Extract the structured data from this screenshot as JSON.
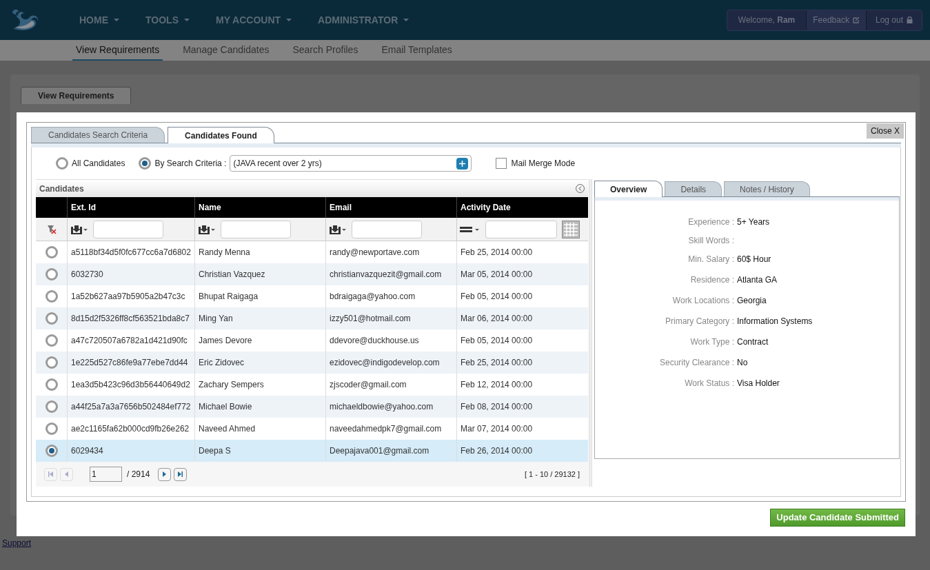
{
  "header": {
    "menu": [
      {
        "label": "HOME"
      },
      {
        "label": "TOOLS"
      },
      {
        "label": "MY ACCOUNT"
      },
      {
        "label": "ADMINISTRATOR"
      }
    ],
    "welcome": "Welcome, **Ram**",
    "feedback": "Feedback",
    "logout": "Log out"
  },
  "subnav": [
    {
      "label": "View Requirements",
      "selected": true
    },
    {
      "label": "Manage Candidates",
      "selected": false
    },
    {
      "label": "Search Profiles",
      "selected": false
    },
    {
      "label": "Email Templates",
      "selected": false
    }
  ],
  "page_tab": "View Requirements",
  "footer_link": "Support",
  "dialog": {
    "close": "Close X",
    "tabs": [
      {
        "label": "Candidates Search Criteria",
        "selected": false
      },
      {
        "label": "Candidates Found",
        "selected": true
      }
    ],
    "scope": [
      {
        "label": "All Candidates",
        "selected": false
      },
      {
        "label": "By Search Criteria :",
        "selected": true
      }
    ],
    "criteria": "(JAVA recent over 2 yrs)",
    "mail_merge": {
      "label": "Mail Merge Mode",
      "checked": false
    },
    "grid": {
      "title": "Candidates",
      "columns": [
        "Ext. Id",
        "Name",
        "Email",
        "Activity Date"
      ],
      "rows": [
        {
          "selected": false,
          "cells": [
            "a5118bf34d5f0fc677cc6a7d6802",
            "Randy Menna",
            "randy@newportave.com",
            "Feb 25, 2014 00:00"
          ]
        },
        {
          "selected": false,
          "cells": [
            "6032730",
            "Christian Vazquez",
            "christianvazquezit@gmail.com",
            "Mar 05, 2014 00:00"
          ]
        },
        {
          "selected": false,
          "cells": [
            "1a52b627aa97b5905a2b47c3c",
            "Bhupat Raigaga",
            "bdraigaga@yahoo.com",
            "Feb 05, 2014 00:00"
          ]
        },
        {
          "selected": false,
          "cells": [
            "8d15d2f5326ff8cf563521bda8c7",
            "Ming Yan",
            "izzy501@hotmail.com",
            "Mar 06, 2014 00:00"
          ]
        },
        {
          "selected": false,
          "cells": [
            "a47c720507a6782a1d421d90fc",
            "James Devore",
            "ddevore@duckhouse.us",
            "Feb 05, 2014 00:00"
          ]
        },
        {
          "selected": false,
          "cells": [
            "1e225d527c86fe9a77ebe7dd44",
            "Eric Zidovec",
            "ezidovec@indigodevelop.com",
            "Feb 25, 2014 00:00"
          ]
        },
        {
          "selected": false,
          "cells": [
            "1ea3d5b423c96d3b56440649d2",
            "Zachary Sempers",
            "zjscoder@gmail.com",
            "Feb 12, 2014 00:00"
          ]
        },
        {
          "selected": false,
          "cells": [
            "a44f25a7a3a7656b502484ef772",
            "Michael Bowie",
            "michaeldbowie@yahoo.com",
            "Feb 08, 2014 00:00"
          ]
        },
        {
          "selected": false,
          "cells": [
            "ae2c1165fa62b000cd9fb26e262",
            "Naveed Ahmed",
            "naveedahmedpk7@gmail.com",
            "Mar 07, 2014 00:00"
          ]
        },
        {
          "selected": true,
          "cells": [
            "6029434",
            "Deepa S",
            "Deepajava001@gmail.com",
            "Feb 26, 2014 00:00"
          ]
        }
      ],
      "page": "1",
      "pages": "/ 2914",
      "range": "[ 1 - 10 / 29132 ]"
    },
    "detail_tabs": [
      {
        "label": "Overview",
        "selected": true
      },
      {
        "label": "Details",
        "selected": false
      },
      {
        "label": "Notes / History",
        "selected": false
      }
    ],
    "overview": [
      {
        "label": "Experience :",
        "value": "5+ Years"
      },
      {
        "label": "Skill Words :"
      },
      {
        "label": "Min. Salary :",
        "value": "60$ Hour"
      },
      {
        "label": "Residence :",
        "value": "Atlanta GA"
      },
      {
        "label": "Work Locations :",
        "value": "Georgia"
      },
      {
        "label": "Primary Category :",
        "value": "Information Systems"
      },
      {
        "label": "Work Type :",
        "value": "Contract"
      },
      {
        "label": "Security Clearance :",
        "value": "No"
      },
      {
        "label": "Work Status :",
        "value": "Visa Holder"
      }
    ],
    "submit": "Update Candidate Submitted"
  }
}
